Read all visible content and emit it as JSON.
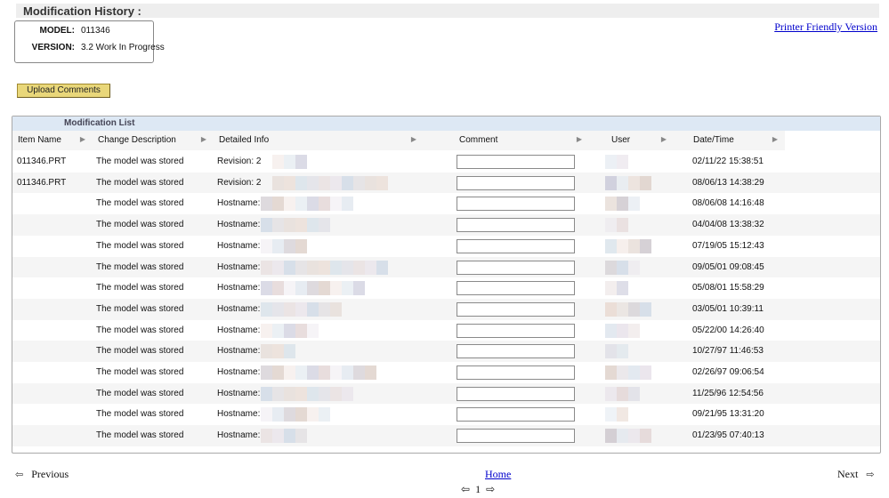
{
  "header": {
    "title": "Modification History :",
    "printer_link": "Printer Friendly Version"
  },
  "model": {
    "model_label": "MODEL:",
    "model_value": "011346",
    "version_label": "VERSION:",
    "version_value": "3.2 Work In Progress"
  },
  "actions": {
    "upload_label": "Upload Comments"
  },
  "list": {
    "title": "Modification List",
    "columns": [
      "Item Name",
      "Change Description",
      "Detailed Info",
      "Comment",
      "User",
      "Date/Time"
    ],
    "rows": [
      {
        "item": "011346.PRT",
        "desc": "The model was stored",
        "info": "Revision: 2",
        "datetime": "02/11/22 15:38:51"
      },
      {
        "item": "011346.PRT",
        "desc": "The model was stored",
        "info": "Revision: 2",
        "datetime": "08/06/13 14:38:29"
      },
      {
        "item": "",
        "desc": "The model was stored",
        "info": "Hostname:",
        "datetime": "08/06/08 14:16:48"
      },
      {
        "item": "",
        "desc": "The model was stored",
        "info": "Hostname:",
        "datetime": "04/04/08 13:38:32"
      },
      {
        "item": "",
        "desc": "The model was stored",
        "info": "Hostname:",
        "datetime": "07/19/05 15:12:43"
      },
      {
        "item": "",
        "desc": "The model was stored",
        "info": "Hostname:",
        "datetime": "09/05/01 09:08:45"
      },
      {
        "item": "",
        "desc": "The model was stored",
        "info": "Hostname:",
        "datetime": "05/08/01 15:58:29"
      },
      {
        "item": "",
        "desc": "The model was stored",
        "info": "Hostname:",
        "datetime": "03/05/01 10:39:11"
      },
      {
        "item": "",
        "desc": "The model was stored",
        "info": "Hostname:",
        "datetime": "05/22/00 14:26:40"
      },
      {
        "item": "",
        "desc": "The model was stored",
        "info": "Hostname:",
        "datetime": "10/27/97 11:46:53"
      },
      {
        "item": "",
        "desc": "The model was stored",
        "info": "Hostname:",
        "datetime": "02/26/97 09:06:54"
      },
      {
        "item": "",
        "desc": "The model was stored",
        "info": "Hostname:",
        "datetime": "11/25/96 12:54:56"
      },
      {
        "item": "",
        "desc": "The model was stored",
        "info": "Hostname:",
        "datetime": "09/21/95 13:31:20"
      },
      {
        "item": "",
        "desc": "The model was stored",
        "info": "Hostname:",
        "datetime": "01/23/95 07:40:13"
      }
    ]
  },
  "footer": {
    "previous": "Previous",
    "home": "Home",
    "next": "Next",
    "page": "1"
  },
  "icons": {
    "previous": "arrow-left-icon",
    "next": "arrow-right-icon",
    "sort": "sort-arrow-icon"
  },
  "colors": {
    "upload_button": "#e9d77a",
    "panel_header": "#dde8f4",
    "link": "#0000cc"
  }
}
